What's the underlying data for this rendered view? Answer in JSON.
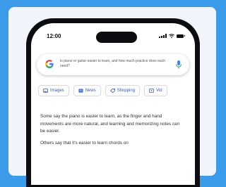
{
  "status_bar": {
    "time": "12:00"
  },
  "search": {
    "query": "Is piano or guitar easier to learn, and how much practice does each need?"
  },
  "chips": [
    {
      "label": "Images",
      "icon": "image-icon"
    },
    {
      "label": "News",
      "icon": "news-icon"
    },
    {
      "label": "Shopping",
      "icon": "shopping-tag-icon"
    },
    {
      "label": "Vid",
      "icon": "video-icon"
    }
  ],
  "answer": {
    "paragraph_1": "Some say the piano is easier to learn, as the finger and hand movements are more natural, and learning and memorizing notes can be easier.",
    "paragraph_2": "Others say that it's easier to learn chords on"
  },
  "colors": {
    "background": "#3a9bea",
    "chip_text": "#2a5cc7",
    "google_blue": "#4285f4",
    "google_red": "#ea4335",
    "google_yellow": "#fbbc05",
    "google_green": "#34a853"
  }
}
